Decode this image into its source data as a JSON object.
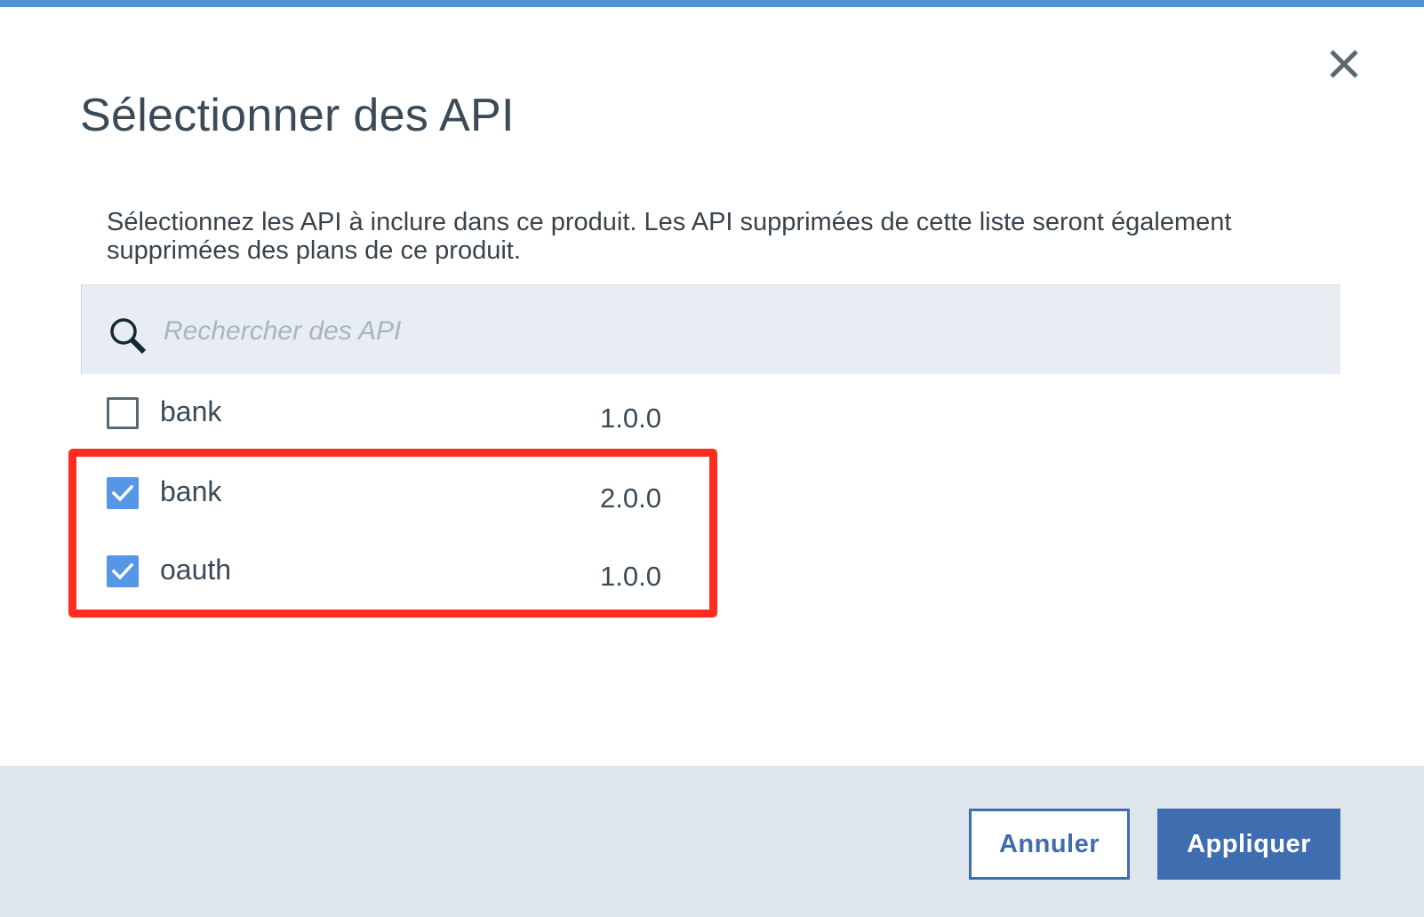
{
  "dialog": {
    "title": "Sélectionner des API",
    "description": "Sélectionnez les API à inclure dans ce produit. Les API supprimées de cette liste seront également supprimées des plans de ce produit.",
    "close_icon": "close-icon"
  },
  "search": {
    "placeholder": "Rechercher des API",
    "value": "",
    "icon": "search-icon"
  },
  "apis": [
    {
      "name": "bank",
      "version": "1.0.0",
      "checked": false
    },
    {
      "name": "bank",
      "version": "2.0.0",
      "checked": true
    },
    {
      "name": "oauth",
      "version": "1.0.0",
      "checked": true
    }
  ],
  "footer": {
    "cancel_label": "Annuler",
    "apply_label": "Appliquer"
  },
  "colors": {
    "accent": "#4f94d9",
    "primary_button": "#3f6eb0",
    "checkbox_checked": "#5596e6",
    "highlight": "#ff2d20",
    "footer_bg": "#dfe5ec",
    "search_bg": "#e7edf3"
  }
}
